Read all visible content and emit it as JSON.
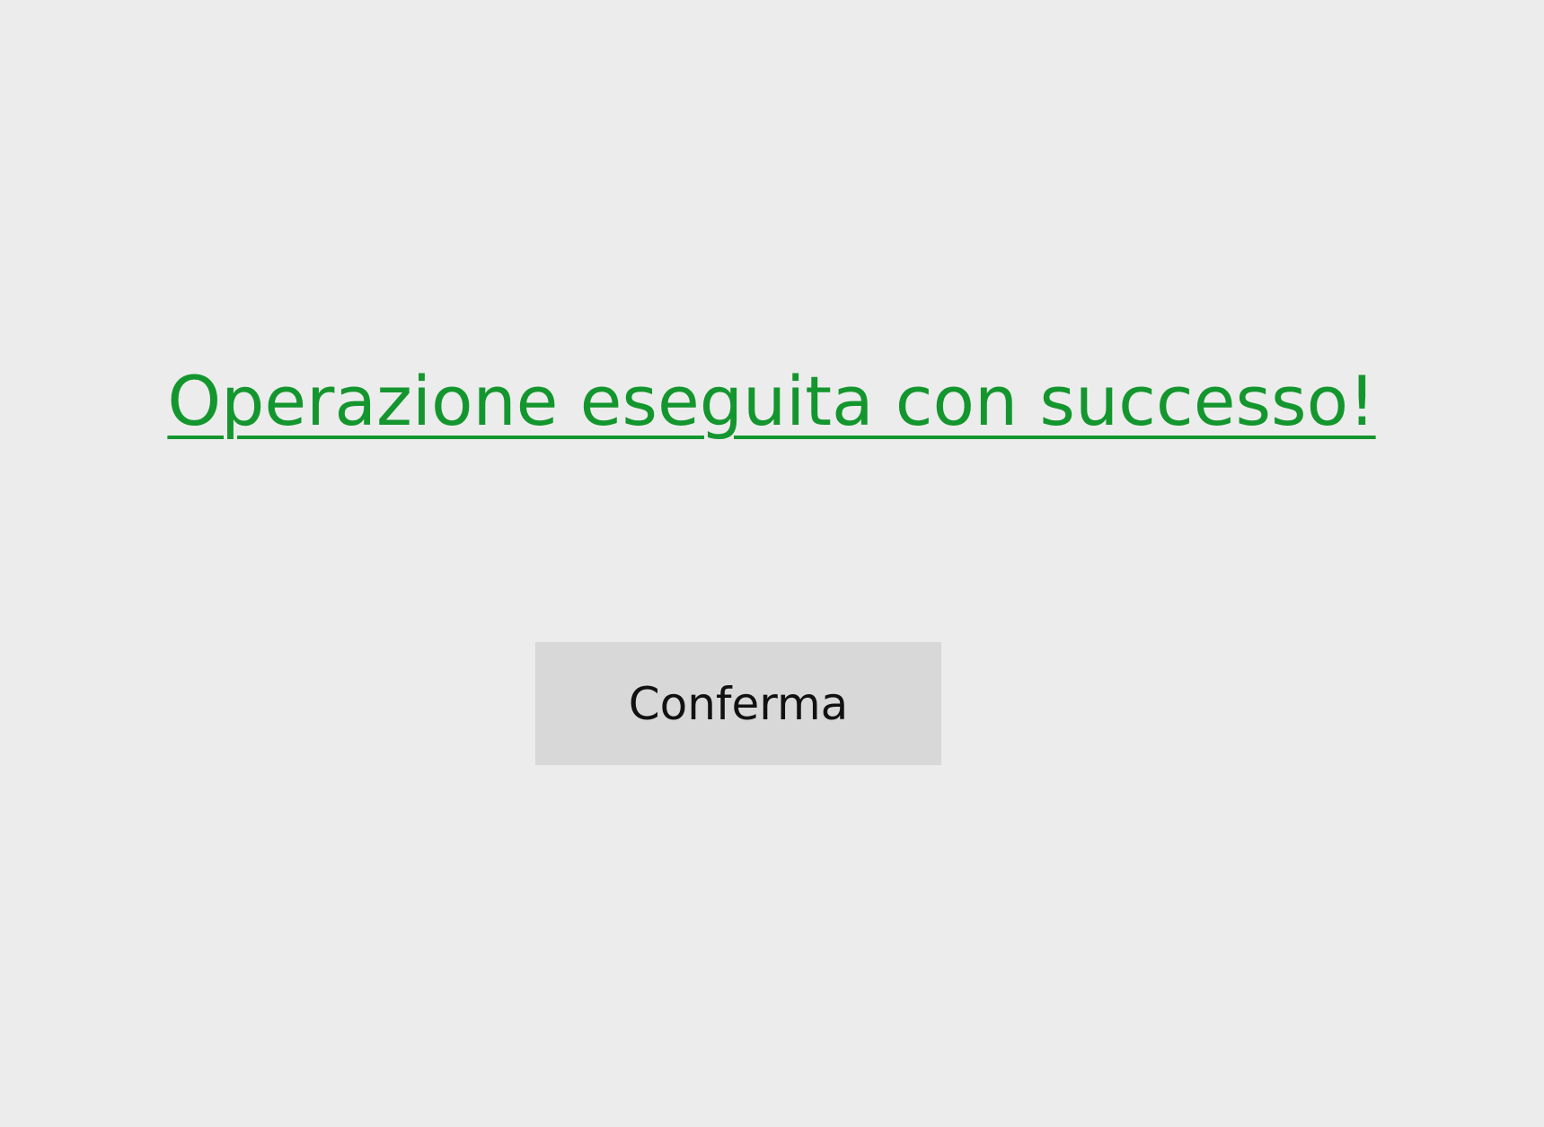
{
  "message": {
    "text": "Operazione eseguita con successo!",
    "color": "#14962e"
  },
  "confirm_button": {
    "label": "Conferma"
  },
  "colors": {
    "background": "#ececec",
    "button_background": "#d8d8d8",
    "success": "#14962e"
  }
}
